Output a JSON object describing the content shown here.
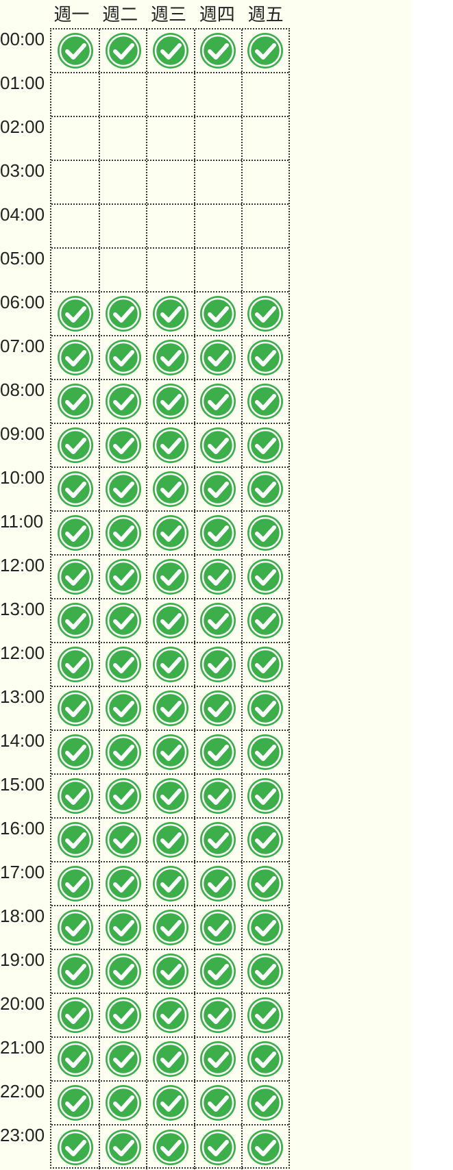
{
  "days": [
    "週一",
    "週二",
    "週三",
    "週四",
    "週五"
  ],
  "rows": [
    {
      "time": "00:00",
      "checks": [
        true,
        true,
        true,
        true,
        true
      ]
    },
    {
      "time": "01:00",
      "checks": [
        false,
        false,
        false,
        false,
        false
      ]
    },
    {
      "time": "02:00",
      "checks": [
        false,
        false,
        false,
        false,
        false
      ]
    },
    {
      "time": "03:00",
      "checks": [
        false,
        false,
        false,
        false,
        false
      ]
    },
    {
      "time": "04:00",
      "checks": [
        false,
        false,
        false,
        false,
        false
      ]
    },
    {
      "time": "05:00",
      "checks": [
        false,
        false,
        false,
        false,
        false
      ]
    },
    {
      "time": "06:00",
      "checks": [
        true,
        true,
        true,
        true,
        true
      ]
    },
    {
      "time": "07:00",
      "checks": [
        true,
        true,
        true,
        true,
        true
      ]
    },
    {
      "time": "08:00",
      "checks": [
        true,
        true,
        true,
        true,
        true
      ]
    },
    {
      "time": "09:00",
      "checks": [
        true,
        true,
        true,
        true,
        true
      ]
    },
    {
      "time": "10:00",
      "checks": [
        true,
        true,
        true,
        true,
        true
      ]
    },
    {
      "time": "11:00",
      "checks": [
        true,
        true,
        true,
        true,
        true
      ]
    },
    {
      "time": "12:00",
      "checks": [
        true,
        true,
        true,
        true,
        true
      ]
    },
    {
      "time": "13:00",
      "checks": [
        true,
        true,
        true,
        true,
        true
      ]
    },
    {
      "time": "12:00",
      "checks": [
        true,
        true,
        true,
        true,
        true
      ]
    },
    {
      "time": "13:00",
      "checks": [
        true,
        true,
        true,
        true,
        true
      ]
    },
    {
      "time": "14:00",
      "checks": [
        true,
        true,
        true,
        true,
        true
      ]
    },
    {
      "time": "15:00",
      "checks": [
        true,
        true,
        true,
        true,
        true
      ]
    },
    {
      "time": "16:00",
      "checks": [
        true,
        true,
        true,
        true,
        true
      ]
    },
    {
      "time": "17:00",
      "checks": [
        true,
        true,
        true,
        true,
        true
      ]
    },
    {
      "time": "18:00",
      "checks": [
        true,
        true,
        true,
        true,
        true
      ]
    },
    {
      "time": "19:00",
      "checks": [
        true,
        true,
        true,
        true,
        true
      ]
    },
    {
      "time": "20:00",
      "checks": [
        true,
        true,
        true,
        true,
        true
      ]
    },
    {
      "time": "21:00",
      "checks": [
        true,
        true,
        true,
        true,
        true
      ]
    },
    {
      "time": "22:00",
      "checks": [
        true,
        true,
        true,
        true,
        true
      ]
    },
    {
      "time": "23:00",
      "checks": [
        true,
        true,
        true,
        true,
        true
      ]
    }
  ],
  "colors": {
    "check_fill": "#3daf4a",
    "check_ring": "#ffffff",
    "panel_bg": "#fdfff0"
  },
  "icon": "check-circle-icon"
}
